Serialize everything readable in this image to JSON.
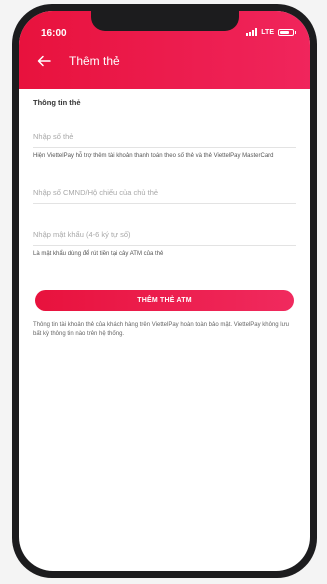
{
  "status_bar": {
    "time": "16:00",
    "network": "LTE"
  },
  "header": {
    "title": "Thêm thẻ",
    "back_icon": "back-arrow-icon",
    "background_color": "#e8123d"
  },
  "form": {
    "section_title": "Thông tin thẻ",
    "card_number": {
      "placeholder": "Nhập số thẻ",
      "value": "",
      "hint": "Hiện ViettelPay hỗ trợ thêm tài khoản thanh toán theo số thẻ và thẻ ViettelPay MasterCard"
    },
    "id_number": {
      "placeholder": "Nhập số CMND/Hộ chiếu của chủ thẻ",
      "value": ""
    },
    "pin": {
      "placeholder": "Nhập mật khẩu (4-6 ký tự số)",
      "value": "",
      "hint": "Là mật khẩu dùng để rút tiền tại cây ATM của thẻ"
    }
  },
  "actions": {
    "add_button_label": "THÊM THẺ ATM",
    "button_color": "#e8123d"
  },
  "footer_note": "Thông tin tài khoản thẻ của khách hàng trên ViettelPay hoàn toàn bảo mật. ViettelPay không lưu bất kỳ thông tin nào trên hệ thống."
}
